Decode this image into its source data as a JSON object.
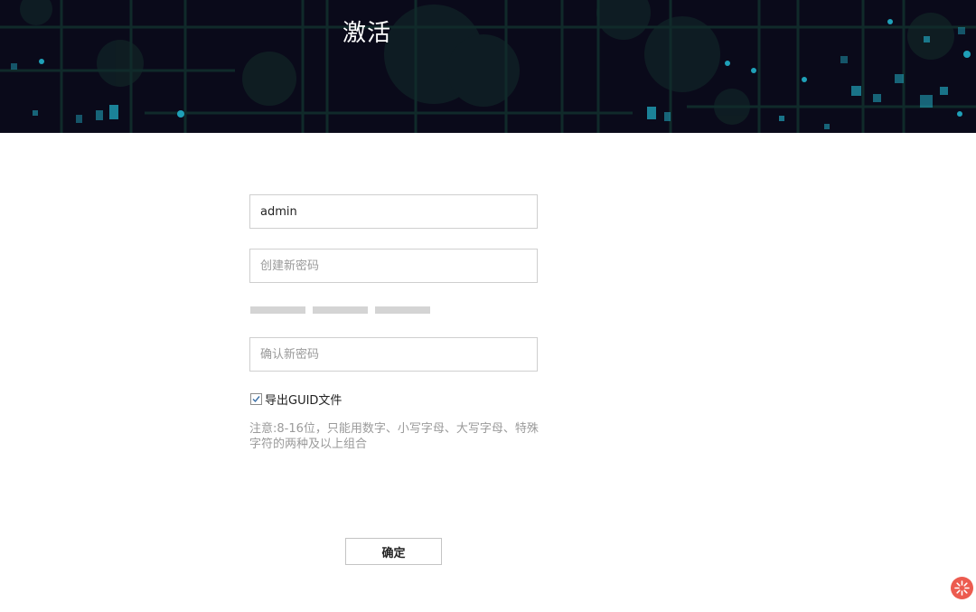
{
  "header": {
    "title": "激活",
    "background_color": "#0a0a1a",
    "accent_color": "#1fa0b8"
  },
  "form": {
    "username": {
      "value": "admin",
      "placeholder": ""
    },
    "new_password": {
      "value": "",
      "placeholder": "创建新密码"
    },
    "confirm_password": {
      "value": "",
      "placeholder": "确认新密码"
    },
    "password_strength_level": 0,
    "export_guid": {
      "label": "导出GUID文件",
      "checked": true
    },
    "note": "注意:8-16位，只能用数字、小写字母、大写字母、特殊字符的两种及以上组合",
    "submit_label": "确定"
  },
  "floating_widget": {
    "icon": "sparkle-icon",
    "color": "#ec5b4f"
  }
}
